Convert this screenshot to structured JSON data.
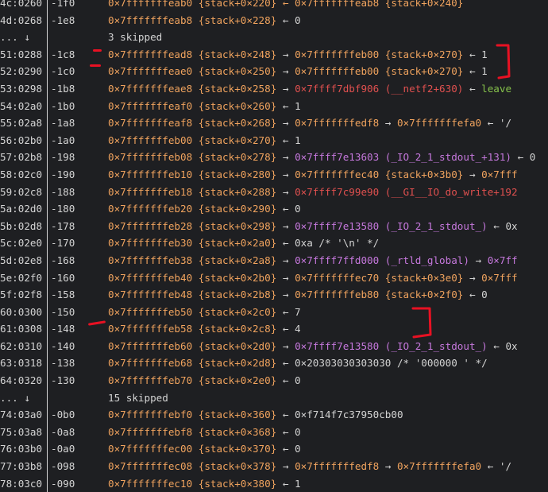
{
  "rows": [
    {
      "index": "4c:0260",
      "offset": "-1f0",
      "segments": [
        {
          "text": "0×7fffffffeab0 {stack+0×220} ← 0×7fffffffeab8 {stack+0×240}",
          "color": "#f0a35e"
        }
      ]
    },
    {
      "index": "4d:0268",
      "offset": "-1e8",
      "segments": [
        {
          "text": "0×7fffffffeab8 {stack+0×228} ",
          "color": "#f0a35e"
        },
        {
          "text": "← 0",
          "color": "#d4d4d4"
        }
      ]
    },
    {
      "index": "... ↓",
      "offset": "",
      "segments": [
        {
          "text": "3 skipped",
          "color": "#d4d4d4"
        }
      ]
    },
    {
      "index": "51:0288",
      "offset": "-1c8",
      "segments": [
        {
          "text": "0×7fffffffead8 {stack+0×248} ",
          "color": "#f0a35e"
        },
        {
          "text": "→ ",
          "color": "#d4d4d4"
        },
        {
          "text": "0×7fffffffeb00 {stack+0×270} ",
          "color": "#f0a35e"
        },
        {
          "text": "← 1",
          "color": "#d4d4d4"
        }
      ]
    },
    {
      "index": "52:0290",
      "offset": "-1c0",
      "segments": [
        {
          "text": "0×7fffffffeae0 {stack+0×250} ",
          "color": "#f0a35e"
        },
        {
          "text": "→ ",
          "color": "#d4d4d4"
        },
        {
          "text": "0×7fffffffeb00 {stack+0×270} ",
          "color": "#f0a35e"
        },
        {
          "text": "← 1",
          "color": "#d4d4d4"
        }
      ]
    },
    {
      "index": "53:0298",
      "offset": "-1b8",
      "segments": [
        {
          "text": "0×7fffffffeae8 {stack+0×258} ",
          "color": "#f0a35e"
        },
        {
          "text": "→ ",
          "color": "#d4d4d4"
        },
        {
          "text": "0×7ffff7dbf906 (__netf2+630) ",
          "color": "#e0504f"
        },
        {
          "text": "← ",
          "color": "#d4d4d4"
        },
        {
          "text": "leave",
          "color": "#86c24b"
        }
      ]
    },
    {
      "index": "54:02a0",
      "offset": "-1b0",
      "segments": [
        {
          "text": "0×7fffffffeaf0 {stack+0×260} ",
          "color": "#f0a35e"
        },
        {
          "text": "← 1",
          "color": "#d4d4d4"
        }
      ]
    },
    {
      "index": "55:02a8",
      "offset": "-1a8",
      "segments": [
        {
          "text": "0×7fffffffeaf8 {stack+0×268} ",
          "color": "#f0a35e"
        },
        {
          "text": "→ ",
          "color": "#d4d4d4"
        },
        {
          "text": "0×7fffffffedf8 ",
          "color": "#f0a35e"
        },
        {
          "text": "→ ",
          "color": "#d4d4d4"
        },
        {
          "text": "0×7fffffffefa0 ",
          "color": "#f0a35e"
        },
        {
          "text": "← '/",
          "color": "#d4d4d4"
        }
      ]
    },
    {
      "index": "56:02b0",
      "offset": "-1a0",
      "segments": [
        {
          "text": "0×7fffffffeb00 {stack+0×270} ",
          "color": "#f0a35e"
        },
        {
          "text": "← 1",
          "color": "#d4d4d4"
        }
      ]
    },
    {
      "index": "57:02b8",
      "offset": "-198",
      "segments": [
        {
          "text": "0×7fffffffeb08 {stack+0×278} ",
          "color": "#f0a35e"
        },
        {
          "text": "→ ",
          "color": "#d4d4d4"
        },
        {
          "text": "0×7ffff7e13603 (_IO_2_1_stdout_+131) ",
          "color": "#c678dd"
        },
        {
          "text": "← 0",
          "color": "#d4d4d4"
        }
      ]
    },
    {
      "index": "58:02c0",
      "offset": "-190",
      "segments": [
        {
          "text": "0×7fffffffeb10 {stack+0×280} ",
          "color": "#f0a35e"
        },
        {
          "text": "→ ",
          "color": "#d4d4d4"
        },
        {
          "text": "0×7fffffffec40 {stack+0×3b0} ",
          "color": "#f0a35e"
        },
        {
          "text": "→ ",
          "color": "#d4d4d4"
        },
        {
          "text": "0×7fff",
          "color": "#f0a35e"
        }
      ]
    },
    {
      "index": "59:02c8",
      "offset": "-188",
      "segments": [
        {
          "text": "0×7fffffffeb18 {stack+0×288} ",
          "color": "#f0a35e"
        },
        {
          "text": "→ ",
          "color": "#d4d4d4"
        },
        {
          "text": "0×7ffff7c99e90 (__GI__IO_do_write+192",
          "color": "#e0504f"
        }
      ]
    },
    {
      "index": "5a:02d0",
      "offset": "-180",
      "segments": [
        {
          "text": "0×7fffffffeb20 {stack+0×290} ",
          "color": "#f0a35e"
        },
        {
          "text": "← 0",
          "color": "#d4d4d4"
        }
      ]
    },
    {
      "index": "5b:02d8",
      "offset": "-178",
      "segments": [
        {
          "text": "0×7fffffffeb28 {stack+0×298} ",
          "color": "#f0a35e"
        },
        {
          "text": "→ ",
          "color": "#d4d4d4"
        },
        {
          "text": "0×7ffff7e13580 (_IO_2_1_stdout_) ",
          "color": "#c678dd"
        },
        {
          "text": "← 0x",
          "color": "#d4d4d4"
        }
      ]
    },
    {
      "index": "5c:02e0",
      "offset": "-170",
      "segments": [
        {
          "text": "0×7fffffffeb30 {stack+0×2a0} ",
          "color": "#f0a35e"
        },
        {
          "text": "← 0xa /* '\\n' */",
          "color": "#d4d4d4"
        }
      ]
    },
    {
      "index": "5d:02e8",
      "offset": "-168",
      "segments": [
        {
          "text": "0×7fffffffeb38 {stack+0×2a8} ",
          "color": "#f0a35e"
        },
        {
          "text": "→ ",
          "color": "#d4d4d4"
        },
        {
          "text": "0×7ffff7ffd000 (_rtld_global) ",
          "color": "#c678dd"
        },
        {
          "text": "→ ",
          "color": "#d4d4d4"
        },
        {
          "text": "0×7ff",
          "color": "#c678dd"
        }
      ]
    },
    {
      "index": "5e:02f0",
      "offset": "-160",
      "segments": [
        {
          "text": "0×7fffffffeb40 {stack+0×2b0} ",
          "color": "#f0a35e"
        },
        {
          "text": "→ ",
          "color": "#d4d4d4"
        },
        {
          "text": "0×7fffffffec70 {stack+0×3e0} ",
          "color": "#f0a35e"
        },
        {
          "text": "→ ",
          "color": "#d4d4d4"
        },
        {
          "text": "0×7fff",
          "color": "#f0a35e"
        }
      ]
    },
    {
      "index": "5f:02f8",
      "offset": "-158",
      "segments": [
        {
          "text": "0×7fffffffeb48 {stack+0×2b8} ",
          "color": "#f0a35e"
        },
        {
          "text": "→ ",
          "color": "#d4d4d4"
        },
        {
          "text": "0×7fffffffeb80 {stack+0×2f0} ",
          "color": "#f0a35e"
        },
        {
          "text": "← 0",
          "color": "#d4d4d4"
        }
      ]
    },
    {
      "index": "60:0300",
      "offset": "-150",
      "segments": [
        {
          "text": "0×7fffffffeb50 {stack+0×2c0} ",
          "color": "#f0a35e"
        },
        {
          "text": "← 7",
          "color": "#d4d4d4"
        }
      ]
    },
    {
      "index": "61:0308",
      "offset": "-148",
      "segments": [
        {
          "text": "0×7fffffffeb58 {stack+0×2c8} ",
          "color": "#f0a35e"
        },
        {
          "text": "← 4",
          "color": "#d4d4d4"
        }
      ]
    },
    {
      "index": "62:0310",
      "offset": "-140",
      "segments": [
        {
          "text": "0×7fffffffeb60 {stack+0×2d0} ",
          "color": "#f0a35e"
        },
        {
          "text": "→ ",
          "color": "#d4d4d4"
        },
        {
          "text": "0×7ffff7e13580 (_IO_2_1_stdout_) ",
          "color": "#c678dd"
        },
        {
          "text": "← 0x",
          "color": "#d4d4d4"
        }
      ]
    },
    {
      "index": "63:0318",
      "offset": "-138",
      "segments": [
        {
          "text": "0×7fffffffeb68 {stack+0×2d8} ",
          "color": "#f0a35e"
        },
        {
          "text": "← 0×20303030303030 /* '000000 ' */",
          "color": "#d4d4d4"
        }
      ]
    },
    {
      "index": "64:0320",
      "offset": "-130",
      "segments": [
        {
          "text": "0×7fffffffeb70 {stack+0×2e0} ",
          "color": "#f0a35e"
        },
        {
          "text": "← 0",
          "color": "#d4d4d4"
        }
      ]
    },
    {
      "index": "... ↓",
      "offset": "",
      "segments": [
        {
          "text": "15 skipped",
          "color": "#d4d4d4"
        }
      ]
    },
    {
      "index": "74:03a0",
      "offset": "-0b0",
      "segments": [
        {
          "text": "0×7fffffffebf0 {stack+0×360} ",
          "color": "#f0a35e"
        },
        {
          "text": "← 0×f714f7c37950cb00",
          "color": "#d4d4d4"
        }
      ]
    },
    {
      "index": "75:03a8",
      "offset": "-0a8",
      "segments": [
        {
          "text": "0×7fffffffebf8 {stack+0×368} ",
          "color": "#f0a35e"
        },
        {
          "text": "← 0",
          "color": "#d4d4d4"
        }
      ]
    },
    {
      "index": "76:03b0",
      "offset": "-0a0",
      "segments": [
        {
          "text": "0×7fffffffec00 {stack+0×370} ",
          "color": "#f0a35e"
        },
        {
          "text": "← 0",
          "color": "#d4d4d4"
        }
      ]
    },
    {
      "index": "77:03b8",
      "offset": "-098",
      "segments": [
        {
          "text": "0×7fffffffec08 {stack+0×378} ",
          "color": "#f0a35e"
        },
        {
          "text": "→ ",
          "color": "#d4d4d4"
        },
        {
          "text": "0×7fffffffedf8 ",
          "color": "#f0a35e"
        },
        {
          "text": "→ ",
          "color": "#d4d4d4"
        },
        {
          "text": "0×7fffffffefa0 ",
          "color": "#f0a35e"
        },
        {
          "text": "← '/",
          "color": "#d4d4d4"
        }
      ]
    },
    {
      "index": "78:03c0",
      "offset": "-090",
      "segments": [
        {
          "text": "0×7fffffffec10 {stack+0×380} ",
          "color": "#f0a35e"
        },
        {
          "text": "← 1",
          "color": "#d4d4d4"
        }
      ]
    }
  ],
  "annotations": {
    "color": "#e81123"
  }
}
